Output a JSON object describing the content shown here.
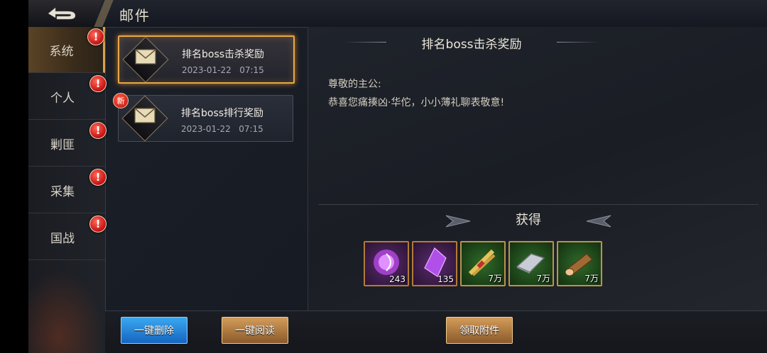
{
  "header": {
    "title": "邮件",
    "back_icon": "back-arrow-icon"
  },
  "sidebar": {
    "items": [
      {
        "label": "系统",
        "active": true,
        "alert": "!"
      },
      {
        "label": "个人",
        "active": false,
        "alert": "!"
      },
      {
        "label": "剿匪",
        "active": false,
        "alert": "!"
      },
      {
        "label": "采集",
        "active": false,
        "alert": "!"
      },
      {
        "label": "国战",
        "active": false,
        "alert": "!"
      }
    ]
  },
  "mails": [
    {
      "subject": "排名boss击杀奖励",
      "date": "2023-01-22",
      "time": "07:15",
      "selected": true,
      "is_new": false
    },
    {
      "subject": "排名boss排行奖励",
      "date": "2023-01-22",
      "time": "07:15",
      "selected": false,
      "is_new": true,
      "new_label": "新"
    }
  ],
  "detail": {
    "title": "排名boss击杀奖励",
    "greeting": "尊敬的主公:",
    "body": "恭喜您痛揍凶·华佗，小小薄礼聊表敬意!",
    "rewards_title": "获得",
    "rewards": [
      {
        "icon": "purple-orb-icon",
        "qty": "243"
      },
      {
        "icon": "purple-crystal-icon",
        "qty": "135"
      },
      {
        "icon": "grain-bundle-icon",
        "qty": "7万"
      },
      {
        "icon": "iron-ingot-icon",
        "qty": "7万"
      },
      {
        "icon": "wood-log-icon",
        "qty": "7万"
      }
    ]
  },
  "footer": {
    "delete_all": "一键删除",
    "read_all": "一键阅读",
    "claim_attachments": "领取附件"
  },
  "colors": {
    "accent_gold": "#e6a84a",
    "alert_red": "#c41010",
    "button_blue": "#1e7fd8"
  }
}
